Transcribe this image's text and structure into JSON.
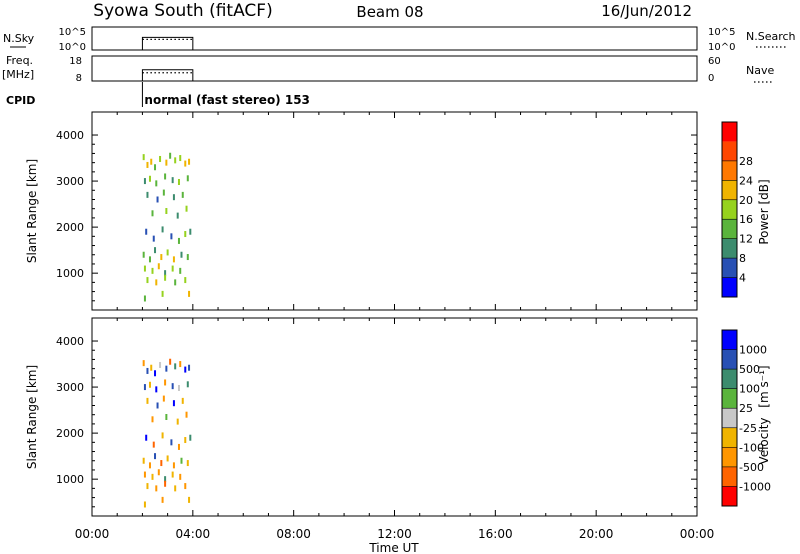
{
  "header": {
    "title": "Syowa South (fitACF)",
    "beam": "Beam 08",
    "date": "16/Jun/2012"
  },
  "panels": {
    "nsky": {
      "label": "N.Sky",
      "ticks_left": [
        "10^5",
        "10^0"
      ],
      "ticks_right": [
        "10^5",
        "10^0"
      ],
      "right_label": "N.Search"
    },
    "freq": {
      "label_line1": "Freq.",
      "label_line2": "[MHz]",
      "ticks_left": [
        "18",
        "8"
      ],
      "ticks_right": [
        "60",
        "0"
      ],
      "right_label": "Nave"
    },
    "cpid": {
      "label": "CPID",
      "text": "normal (fast stereo) 153"
    }
  },
  "axes": {
    "ylabel": "Slant Range [km]",
    "xlabel": "Time UT",
    "y_ticks": [
      "1000",
      "2000",
      "3000",
      "4000"
    ],
    "x_ticks": [
      "00:00",
      "04:00",
      "08:00",
      "12:00",
      "16:00",
      "20:00",
      "00:00"
    ]
  },
  "colorbars": {
    "power": {
      "label": "Power [dB]",
      "ticks": [
        "4",
        "8",
        "12",
        "16",
        "20",
        "24",
        "28"
      ],
      "colors": [
        "#0000ff",
        "#2850b4",
        "#3c8c6e",
        "#5ab43c",
        "#96d21e",
        "#f0b400",
        "#ff7800",
        "#ff4600",
        "#ff0000"
      ]
    },
    "velocity": {
      "label": "Velocity",
      "units": "[m s⁻¹]",
      "ticks": [
        "1000",
        "500",
        "100",
        "25",
        "-25",
        "-100",
        "-500",
        "-1000"
      ],
      "colors": [
        "#0000ff",
        "#2850b4",
        "#3c8c6e",
        "#5ab43c",
        "#c8c8c8",
        "#f0b400",
        "#ff9600",
        "#ff6400",
        "#ff0000"
      ]
    }
  },
  "chart_data": {
    "type": "scatter",
    "x_unit": "hours UT",
    "xlim": [
      0,
      24
    ],
    "ylim": [
      200,
      4500
    ],
    "data_time_range": [
      2.0,
      4.0
    ],
    "cpid_time": 2.0,
    "nsky_level": 0.55,
    "freq_level": 0.45,
    "power_points": [
      {
        "t": 2.05,
        "r": 3520,
        "v": 18
      },
      {
        "t": 2.2,
        "r": 3350,
        "v": 22
      },
      {
        "t": 2.35,
        "r": 3420,
        "v": 20
      },
      {
        "t": 2.5,
        "r": 3300,
        "v": 14
      },
      {
        "t": 2.7,
        "r": 3480,
        "v": 17
      },
      {
        "t": 2.95,
        "r": 3400,
        "v": 21
      },
      {
        "t": 3.1,
        "r": 3550,
        "v": 15
      },
      {
        "t": 3.3,
        "r": 3450,
        "v": 19
      },
      {
        "t": 3.5,
        "r": 3500,
        "v": 16
      },
      {
        "t": 3.7,
        "r": 3380,
        "v": 20
      },
      {
        "t": 3.85,
        "r": 3420,
        "v": 22
      },
      {
        "t": 2.1,
        "r": 3000,
        "v": 8
      },
      {
        "t": 2.3,
        "r": 3050,
        "v": 16
      },
      {
        "t": 2.55,
        "r": 2950,
        "v": 12
      },
      {
        "t": 2.9,
        "r": 3100,
        "v": 15
      },
      {
        "t": 3.2,
        "r": 3020,
        "v": 9
      },
      {
        "t": 3.45,
        "r": 2980,
        "v": 17
      },
      {
        "t": 3.8,
        "r": 3060,
        "v": 14
      },
      {
        "t": 2.2,
        "r": 2700,
        "v": 10
      },
      {
        "t": 2.6,
        "r": 2600,
        "v": 6
      },
      {
        "t": 2.85,
        "r": 2750,
        "v": 13
      },
      {
        "t": 3.25,
        "r": 2650,
        "v": 8
      },
      {
        "t": 3.6,
        "r": 2700,
        "v": 15
      },
      {
        "t": 2.4,
        "r": 2300,
        "v": 12
      },
      {
        "t": 2.95,
        "r": 2350,
        "v": 17
      },
      {
        "t": 3.4,
        "r": 2250,
        "v": 9
      },
      {
        "t": 3.75,
        "r": 2400,
        "v": 16
      },
      {
        "t": 2.15,
        "r": 1900,
        "v": 7
      },
      {
        "t": 2.45,
        "r": 1750,
        "v": 4
      },
      {
        "t": 2.8,
        "r": 1950,
        "v": 11
      },
      {
        "t": 3.15,
        "r": 1800,
        "v": 6
      },
      {
        "t": 3.45,
        "r": 1700,
        "v": 14
      },
      {
        "t": 3.7,
        "r": 1850,
        "v": 18
      },
      {
        "t": 3.9,
        "r": 1900,
        "v": 10
      },
      {
        "t": 2.05,
        "r": 1400,
        "v": 15
      },
      {
        "t": 2.3,
        "r": 1300,
        "v": 12
      },
      {
        "t": 2.5,
        "r": 1500,
        "v": 8
      },
      {
        "t": 2.75,
        "r": 1350,
        "v": 21
      },
      {
        "t": 3.0,
        "r": 1450,
        "v": 17
      },
      {
        "t": 3.25,
        "r": 1300,
        "v": 20
      },
      {
        "t": 3.55,
        "r": 1400,
        "v": 9
      },
      {
        "t": 3.8,
        "r": 1350,
        "v": 14
      },
      {
        "t": 2.1,
        "r": 1100,
        "v": 19
      },
      {
        "t": 2.4,
        "r": 1050,
        "v": 16
      },
      {
        "t": 2.65,
        "r": 1150,
        "v": 22
      },
      {
        "t": 2.9,
        "r": 1000,
        "v": 11
      },
      {
        "t": 3.2,
        "r": 1100,
        "v": 18
      },
      {
        "t": 3.5,
        "r": 1050,
        "v": 13
      },
      {
        "t": 2.2,
        "r": 850,
        "v": 17
      },
      {
        "t": 2.55,
        "r": 800,
        "v": 21
      },
      {
        "t": 2.9,
        "r": 900,
        "v": 16
      },
      {
        "t": 3.3,
        "r": 800,
        "v": 15
      },
      {
        "t": 3.7,
        "r": 850,
        "v": 19
      },
      {
        "t": 2.1,
        "r": 450,
        "v": 12
      },
      {
        "t": 2.8,
        "r": 550,
        "v": 16
      },
      {
        "t": 3.85,
        "r": 550,
        "v": 20
      }
    ],
    "velocity_points": [
      {
        "t": 2.05,
        "r": 3520,
        "v": -500
      },
      {
        "t": 2.2,
        "r": 3350,
        "v": 500
      },
      {
        "t": 2.35,
        "r": 3420,
        "v": -100
      },
      {
        "t": 2.5,
        "r": 3300,
        "v": 1000
      },
      {
        "t": 2.7,
        "r": 3480,
        "v": -25
      },
      {
        "t": 2.95,
        "r": 3400,
        "v": 500
      },
      {
        "t": 3.1,
        "r": 3550,
        "v": -1000
      },
      {
        "t": 3.3,
        "r": 3450,
        "v": 100
      },
      {
        "t": 3.5,
        "r": 3500,
        "v": -500
      },
      {
        "t": 3.7,
        "r": 3380,
        "v": 1000
      },
      {
        "t": 3.85,
        "r": 3420,
        "v": 500
      },
      {
        "t": 2.1,
        "r": 3000,
        "v": 500
      },
      {
        "t": 2.3,
        "r": 3050,
        "v": -100
      },
      {
        "t": 2.55,
        "r": 2950,
        "v": 1000
      },
      {
        "t": 2.9,
        "r": 3100,
        "v": -500
      },
      {
        "t": 3.2,
        "r": 3020,
        "v": 500
      },
      {
        "t": 3.45,
        "r": 2980,
        "v": -25
      },
      {
        "t": 3.8,
        "r": 3060,
        "v": 100
      },
      {
        "t": 2.2,
        "r": 2700,
        "v": -100
      },
      {
        "t": 2.6,
        "r": 2600,
        "v": 500
      },
      {
        "t": 2.85,
        "r": 2750,
        "v": -500
      },
      {
        "t": 3.25,
        "r": 2650,
        "v": 1000
      },
      {
        "t": 3.6,
        "r": 2700,
        "v": -100
      },
      {
        "t": 2.4,
        "r": 2300,
        "v": -500
      },
      {
        "t": 2.95,
        "r": 2350,
        "v": 25
      },
      {
        "t": 3.4,
        "r": 2250,
        "v": -100
      },
      {
        "t": 3.75,
        "r": 2400,
        "v": -500
      },
      {
        "t": 2.15,
        "r": 1900,
        "v": 1000
      },
      {
        "t": 2.45,
        "r": 1750,
        "v": -1000
      },
      {
        "t": 2.8,
        "r": 1950,
        "v": -100
      },
      {
        "t": 3.15,
        "r": 1800,
        "v": 500
      },
      {
        "t": 3.45,
        "r": 1700,
        "v": -500
      },
      {
        "t": 3.7,
        "r": 1850,
        "v": -100
      },
      {
        "t": 3.9,
        "r": 1900,
        "v": 100
      },
      {
        "t": 2.05,
        "r": 1400,
        "v": -100
      },
      {
        "t": 2.3,
        "r": 1300,
        "v": -500
      },
      {
        "t": 2.5,
        "r": 1500,
        "v": 500
      },
      {
        "t": 2.75,
        "r": 1350,
        "v": -1000
      },
      {
        "t": 3.0,
        "r": 1450,
        "v": -100
      },
      {
        "t": 3.25,
        "r": 1300,
        "v": -500
      },
      {
        "t": 3.55,
        "r": 1400,
        "v": 25
      },
      {
        "t": 3.8,
        "r": 1350,
        "v": -100
      },
      {
        "t": 2.1,
        "r": 1100,
        "v": -500
      },
      {
        "t": 2.4,
        "r": 1050,
        "v": -100
      },
      {
        "t": 2.65,
        "r": 1150,
        "v": -500
      },
      {
        "t": 2.9,
        "r": 1000,
        "v": 100
      },
      {
        "t": 3.2,
        "r": 1100,
        "v": -100
      },
      {
        "t": 3.5,
        "r": 1050,
        "v": -500
      },
      {
        "t": 2.2,
        "r": 850,
        "v": -100
      },
      {
        "t": 2.55,
        "r": 800,
        "v": -500
      },
      {
        "t": 2.9,
        "r": 900,
        "v": -1000
      },
      {
        "t": 3.3,
        "r": 800,
        "v": -100
      },
      {
        "t": 3.7,
        "r": 850,
        "v": -500
      },
      {
        "t": 2.1,
        "r": 450,
        "v": -100
      },
      {
        "t": 2.8,
        "r": 550,
        "v": -500
      },
      {
        "t": 3.85,
        "r": 550,
        "v": -100
      }
    ]
  }
}
